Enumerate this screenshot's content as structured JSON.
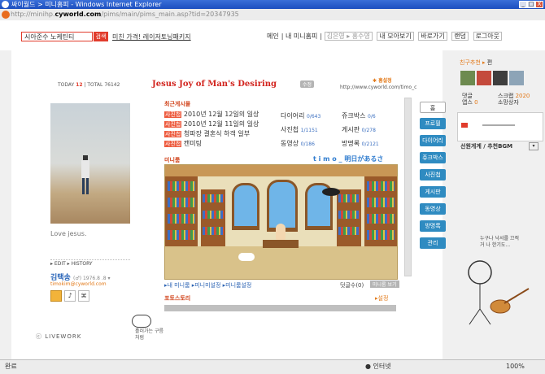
{
  "window": {
    "title": "싸이월드 > 미니홈피 - Windows Internet Explorer",
    "min": "_",
    "max": "□",
    "close": "X"
  },
  "address": {
    "prefix": "http://minihp.",
    "domain": "cyworld.com",
    "path": "/pims/main/pims_main.asp?tid=20347935"
  },
  "topbar": {
    "search_placeholder": "시아준수 노케틴티",
    "search_button": "검색",
    "promo": "미친 가격! 레이저토닝패키지",
    "nav": [
      "메인",
      "내 미니홈피",
      "김은영 ▸ 홍수영",
      "내 모아보기",
      "바로가기",
      "랜덤",
      "로그아웃"
    ]
  },
  "profile": {
    "today_label": "TODAY",
    "today": "12",
    "total_label": "TOTAL",
    "total": "76142",
    "status_text": "Love jesus.",
    "edit": "▸ EDIT ▸ HISTORY",
    "name": "김택송",
    "name_meta": "(♂) 1976.8 .8 ▾",
    "email": "timokim@cyworld.com",
    "logo": "ⓒ LIVEWORK"
  },
  "header": {
    "title": "Jesus Joy of Man's Desiring",
    "edit_btn": "수정",
    "settings": "홈설정",
    "url": "http://www.cyworld.com/timo_c"
  },
  "recent": {
    "title": "최근게시물",
    "items": [
      {
        "tag": "사진첩",
        "text": "2010년 12월 12일의 일상"
      },
      {
        "tag": "사진첩",
        "text": "2010년 12월 11일의 일상"
      },
      {
        "tag": "사진첩",
        "text": "청파장 결혼식 하객 일부"
      },
      {
        "tag": "사진첩",
        "text": "캔미팅"
      }
    ]
  },
  "counts": [
    {
      "label": "다이어리",
      "value": "0/643"
    },
    {
      "label": "쥬크박스",
      "value": "0/6"
    },
    {
      "label": "사진첩",
      "value": "1/1151"
    },
    {
      "label": "게시판",
      "value": "0/278"
    },
    {
      "label": "동영상",
      "value": "0/186"
    },
    {
      "label": "방명록",
      "value": "0/2121"
    }
  ],
  "miniroom": {
    "title": "미니룸",
    "owner": "t i m o _ 明日があるさ",
    "links": "▸내 미니룸 ▸미니미설정 ▸미니룸설정",
    "comment": "덧글수(0)",
    "write": "미니룸 보기"
  },
  "photostory": {
    "title": "포토스토리",
    "setting": "▸설정"
  },
  "menu": [
    "홈",
    "프로필",
    "다이어리",
    "쥬크박스",
    "사진첩",
    "게시판",
    "동영상",
    "방명록",
    "관리"
  ],
  "sidebar": {
    "friends_title": "친구추천",
    "friends_more": "편",
    "reply_label": "댓글",
    "reply_sub": "앱스",
    "reply_val": "0",
    "scrap_label": "스크랩",
    "scrap_val": "2020",
    "scrap_sub": "소망상자",
    "bgm_title": "선원게계 / 추천BGM",
    "doodle": "누구나 낙서를 끄적거 나 한기도..."
  },
  "cloud_text": "흘러가는 구름처럼",
  "status": {
    "left": "완료",
    "zone": "인터넷",
    "zoom": "100%"
  }
}
